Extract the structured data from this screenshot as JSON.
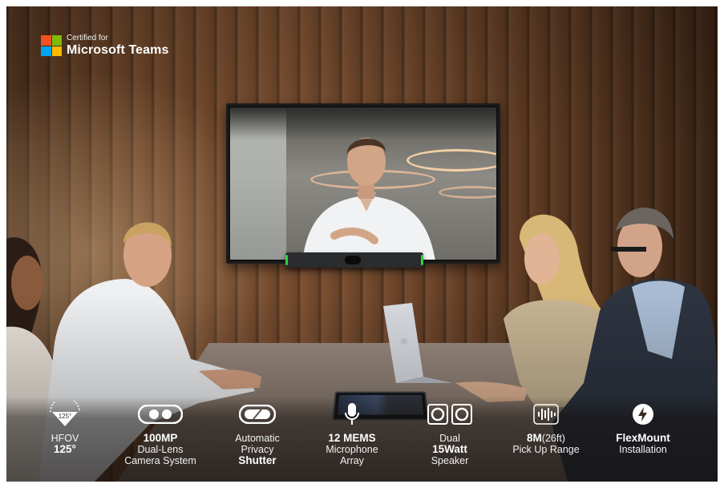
{
  "badge": {
    "certified_for": "Certified for",
    "product": "Microsoft Teams",
    "logo_colors": [
      "#f25022",
      "#7fba00",
      "#00a4ef",
      "#ffb900"
    ]
  },
  "features": [
    {
      "icon": "hfov-icon",
      "icon_text": "125°",
      "lines": [
        "HFOV"
      ],
      "bold": "125°"
    },
    {
      "icon": "dual-lens-icon",
      "bold": "100MP",
      "lines": [
        "Dual-Lens",
        "Camera System"
      ]
    },
    {
      "icon": "shutter-icon",
      "lines": [
        "Automatic",
        "Privacy"
      ],
      "bold": "Shutter"
    },
    {
      "icon": "microphone-icon",
      "bold": "12 MEMS",
      "lines": [
        "Microphone",
        "Array"
      ]
    },
    {
      "icon": "speaker-icon",
      "lines": [
        "Dual"
      ],
      "bold": "15Watt",
      "after": "Speaker"
    },
    {
      "icon": "sound-wave-icon",
      "bold": "8M",
      "bold_suffix": "(26ft)",
      "lines": [
        "Pick Up Range"
      ]
    },
    {
      "icon": "flexmount-icon",
      "bold": "FlexMount",
      "lines": [
        "Installation"
      ]
    }
  ]
}
